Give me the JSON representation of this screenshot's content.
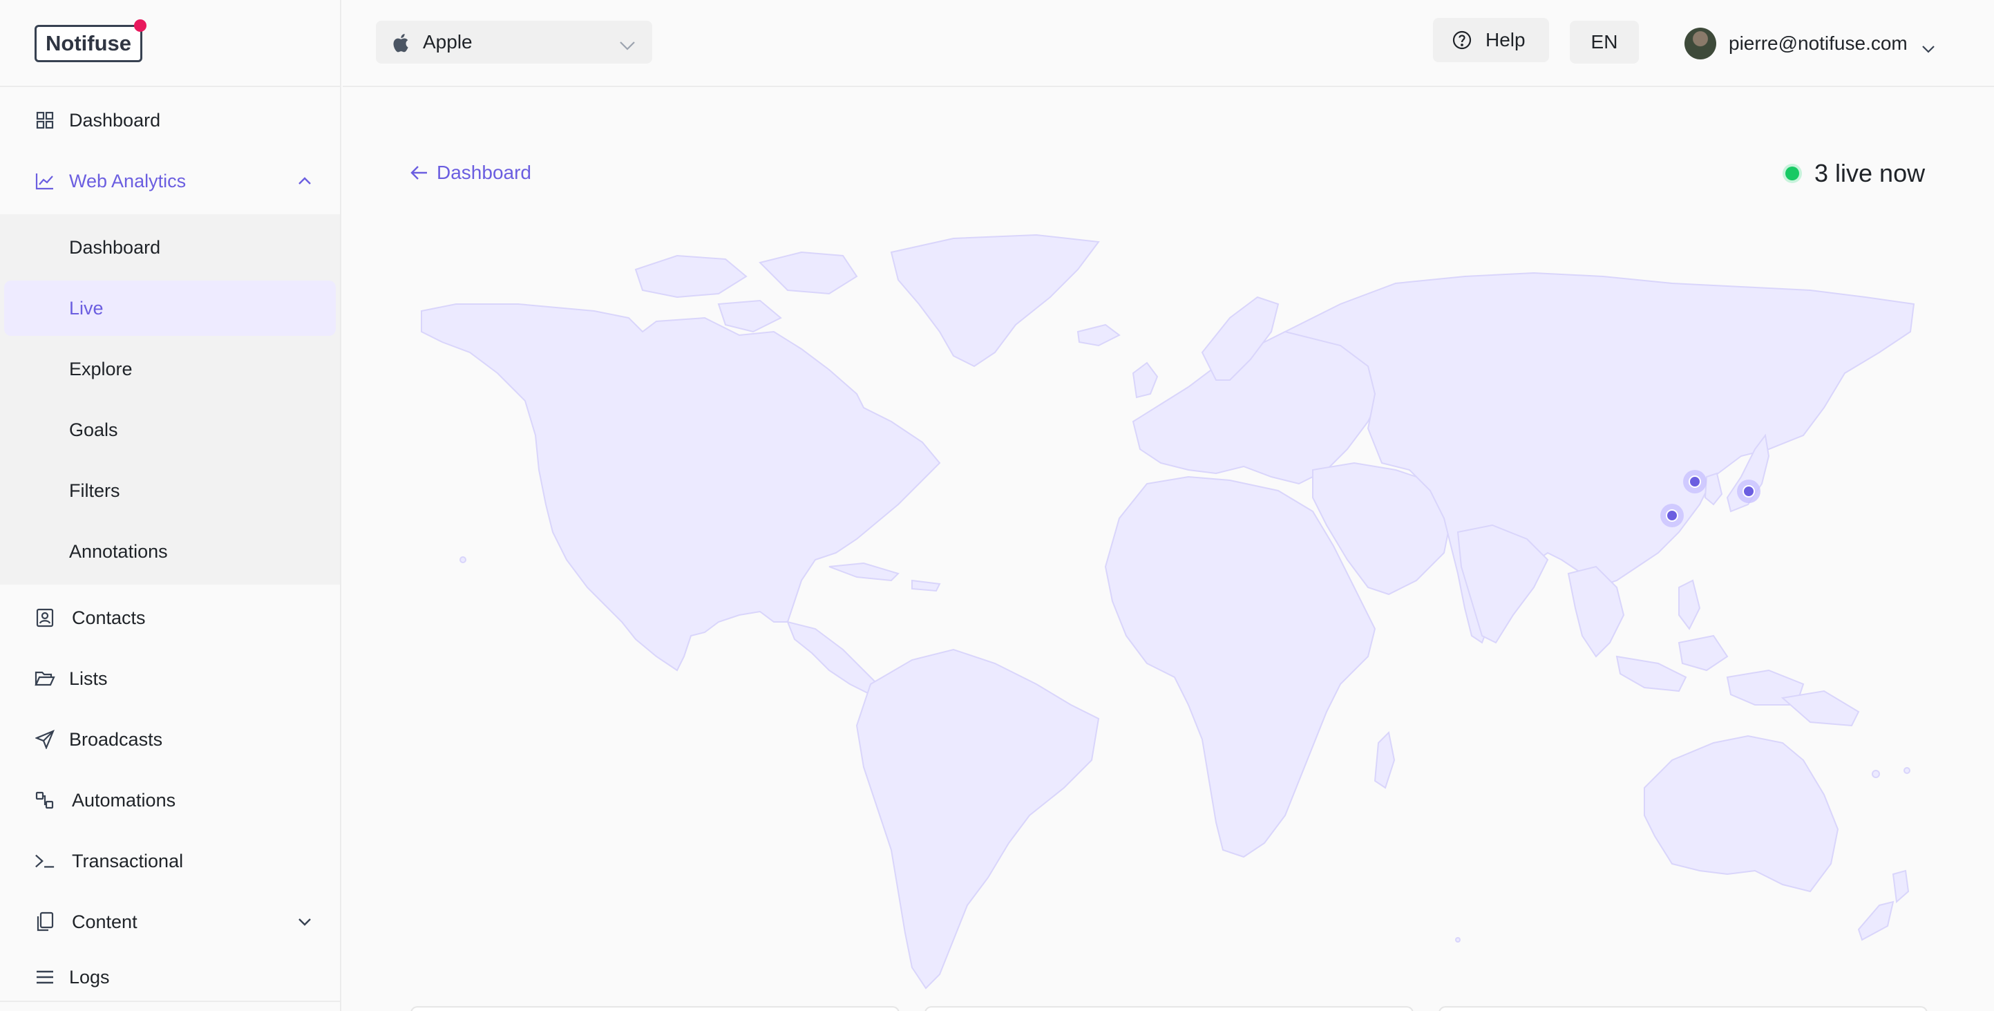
{
  "brand": {
    "name": "Notifuse"
  },
  "sidebar": {
    "items": [
      {
        "label": "Dashboard",
        "icon": "dashboard-grid-icon"
      },
      {
        "label": "Web Analytics",
        "icon": "chart-line-icon",
        "expanded": true
      },
      {
        "label": "Contacts",
        "icon": "contact-card-icon"
      },
      {
        "label": "Lists",
        "icon": "folder-open-icon"
      },
      {
        "label": "Broadcasts",
        "icon": "paper-plane-icon"
      },
      {
        "label": "Automations",
        "icon": "automation-flow-icon"
      },
      {
        "label": "Transactional",
        "icon": "terminal-icon"
      },
      {
        "label": "Content",
        "icon": "copy-pages-icon"
      },
      {
        "label": "Logs",
        "icon": "list-lines-icon"
      }
    ],
    "web_analytics_sub": [
      {
        "label": "Dashboard"
      },
      {
        "label": "Live",
        "active": true
      },
      {
        "label": "Explore"
      },
      {
        "label": "Goals"
      },
      {
        "label": "Filters"
      },
      {
        "label": "Annotations"
      }
    ]
  },
  "header": {
    "org_select": {
      "value": "Apple",
      "icon": "apple-icon"
    },
    "help_label": "Help",
    "language": "EN",
    "user_email": "pierre@notifuse.com"
  },
  "main": {
    "back_label": "Dashboard",
    "live_text": "3 live now",
    "live_count": 3,
    "colors": {
      "accent": "#6b5ee0",
      "map_land": "#eceaff",
      "map_border": "#d9d5fb",
      "live_dot": "#17c964"
    }
  }
}
